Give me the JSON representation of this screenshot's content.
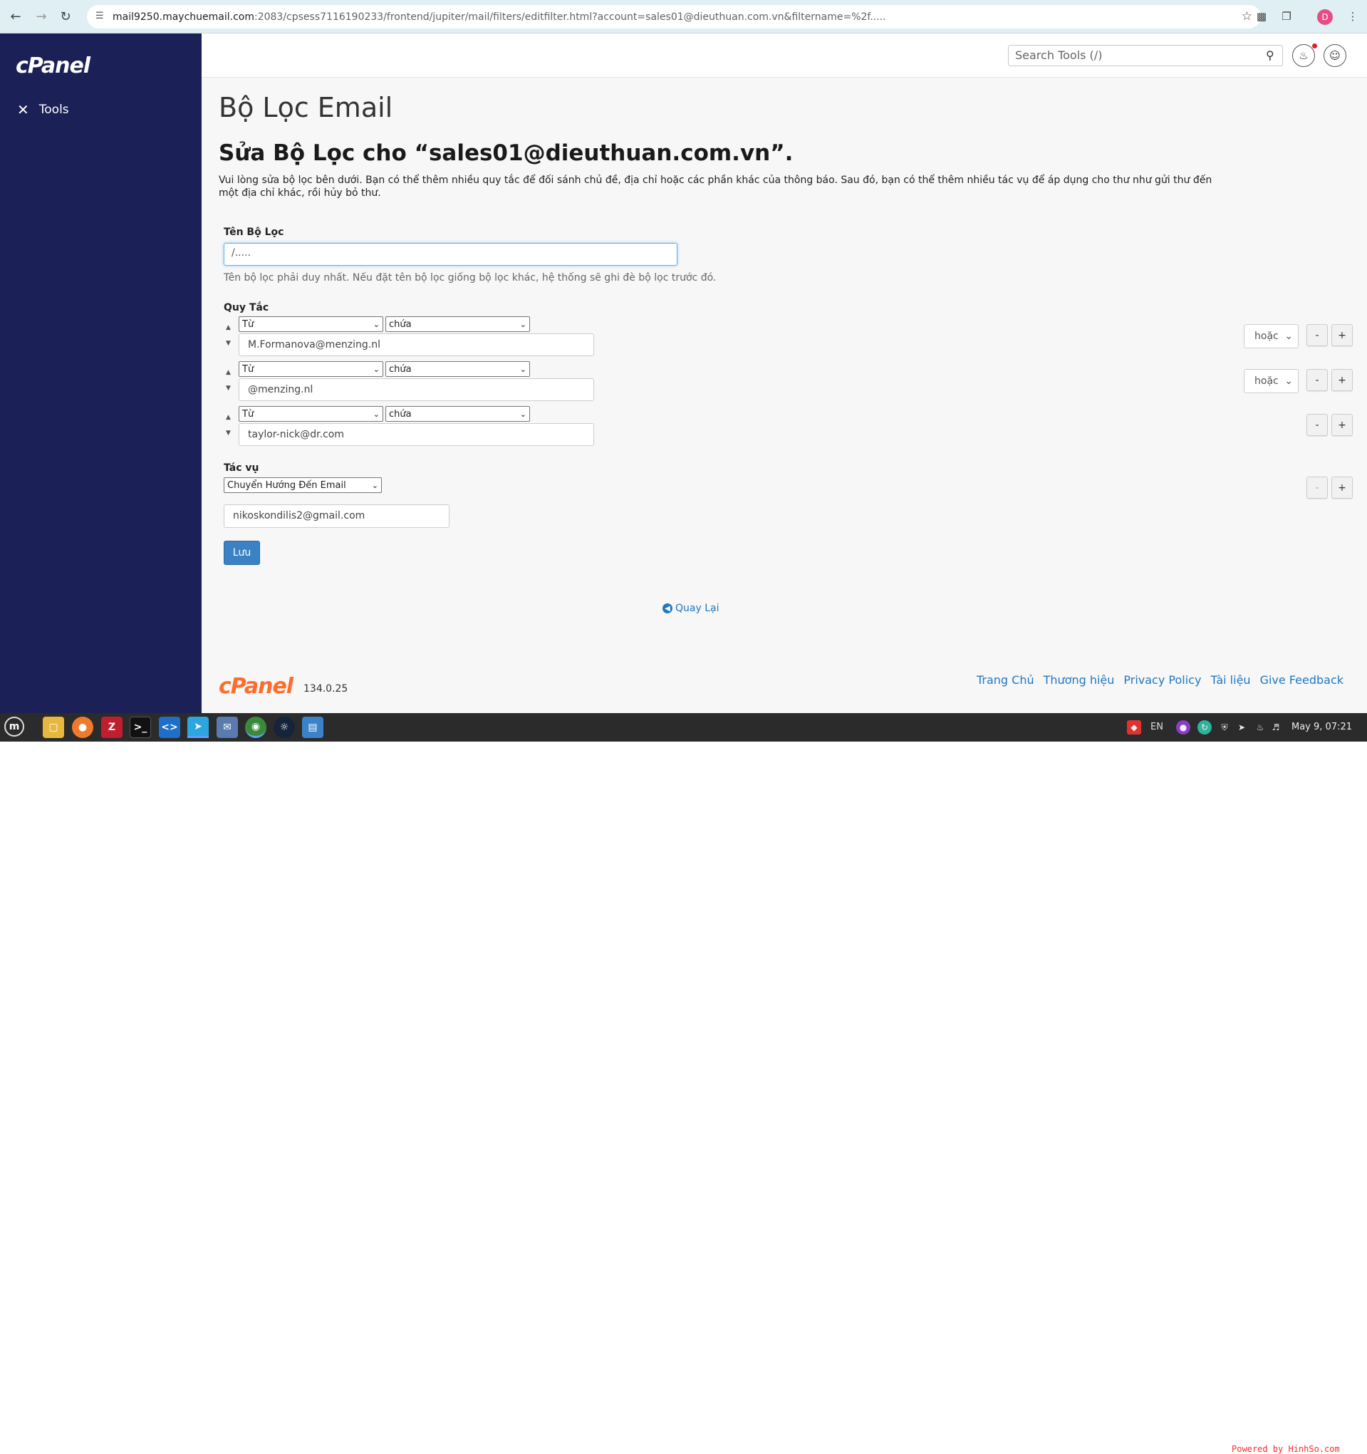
{
  "browser": {
    "url_host": "mail9250.maychuemail.com",
    "url_path": ":2083/cpsess7116190233/frontend/jupiter/mail/filters/editfilter.html?account=sales01@dieuthuan.com.vn&filtername=%2f.....",
    "profile_initial": "D"
  },
  "sidebar": {
    "logo": "cPanel",
    "tools_label": "Tools"
  },
  "header": {
    "search_placeholder": "Search Tools (/)"
  },
  "page": {
    "title": "Bộ Lọc Email",
    "form_title": "Sửa Bộ Lọc cho “sales01@dieuthuan.com.vn”.",
    "description": "Vui lòng sửa bộ lọc bên dưới. Bạn có thể thêm nhiều quy tắc để đối sánh chủ đề, địa chỉ hoặc các phần khác của thông báo. Sau đó, bạn có thể thêm nhiều tác vụ để áp dụng cho thư như gửi thư đến một địa chỉ khác, rồi hủy bỏ thư."
  },
  "filter_name": {
    "label": "Tên Bộ Lọc",
    "value": "/.....",
    "help": "Tên bộ lọc phải duy nhất. Nếu đặt tên bộ lọc giống bộ lọc khác, hệ thống sẽ ghi đè bộ lọc trước đó."
  },
  "rules": {
    "label": "Quy Tắc",
    "items": [
      {
        "part": "Từ",
        "match": "chứa",
        "value": "M.Formanova@menzing.nl",
        "logic": "hoặc"
      },
      {
        "part": "Từ",
        "match": "chứa",
        "value": "@menzing.nl",
        "logic": "hoặc"
      },
      {
        "part": "Từ",
        "match": "chứa",
        "value": "taylor-nick@dr.com",
        "logic": ""
      }
    ],
    "remove_label": "-",
    "add_label": "+"
  },
  "actions": {
    "label": "Tác vụ",
    "action_select": "Chuyển Hướng Đến Email",
    "destination": "nikoskondilis2@gmail.com",
    "remove_label": "-",
    "add_label": "+"
  },
  "save_label": "Lưu",
  "back_label": "Quay Lại",
  "footer": {
    "logo": "cPanel",
    "version": "134.0.25",
    "links": [
      "Trang Chủ",
      "Thương hiệu",
      "Privacy Policy",
      "Tài liệu",
      "Give Feedback"
    ]
  },
  "taskbar": {
    "lang": "EN",
    "clock": "May  9, 07:21",
    "watermark": "Powered by HinhSo.com"
  },
  "colors": {
    "sidebar_bg": "#1b2057",
    "accent": "#3b82c4",
    "cpanel_orange": "#ff6c2c",
    "link": "#2277c0"
  }
}
